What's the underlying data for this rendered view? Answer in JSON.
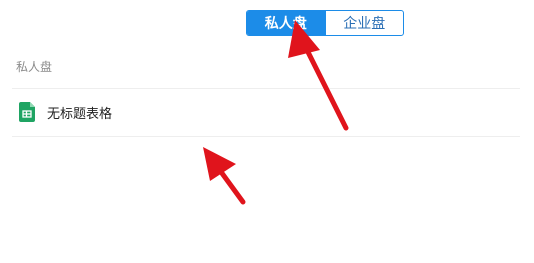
{
  "tabs": {
    "active_label": "私人盘",
    "inactive_label": "企业盘"
  },
  "section": {
    "label": "私人盘"
  },
  "files": [
    {
      "name": "无标题表格",
      "icon": "spreadsheet-icon",
      "icon_color": "#1fa463"
    }
  ],
  "colors": {
    "accent": "#1c8ce8",
    "annotation_arrow": "#e0141c"
  }
}
